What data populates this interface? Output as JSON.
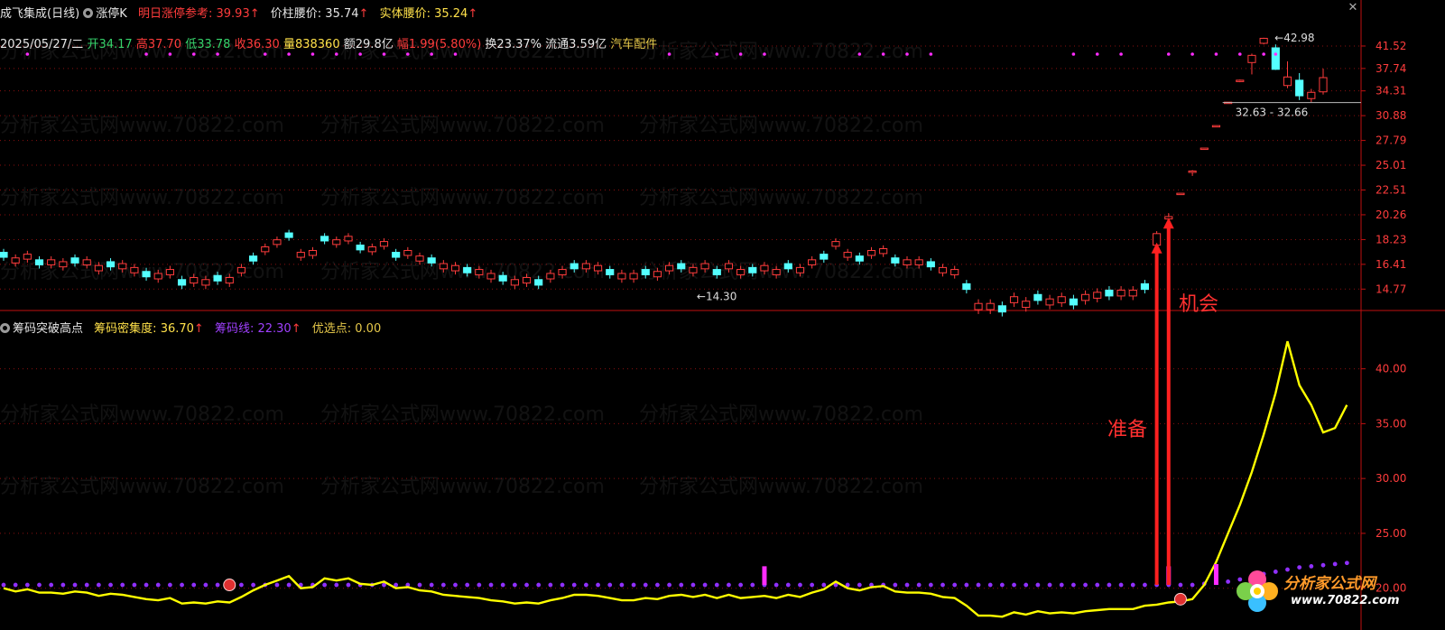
{
  "header": {
    "title": "成飞集成(日线)",
    "indicator_name": "涨停K",
    "ref_label": "明日涨停参考:",
    "ref_value": "39.93",
    "waist_label": "价柱腰价:",
    "waist_value": "35.74",
    "body_waist_label": "实体腰价:",
    "body_waist_value": "35.24",
    "up_arrow": "↑",
    "close_glyph": "✕"
  },
  "quote": {
    "date": "2025/05/27/二",
    "open_label": "开",
    "open": "34.17",
    "high_label": "高",
    "high": "37.70",
    "low_label": "低",
    "low": "33.78",
    "close_label": "收",
    "close": "36.30",
    "vol_label": "量",
    "vol": "838360",
    "amt_label": "额",
    "amt": "29.8亿",
    "chg_label": "幅",
    "chg": "1.99(5.80%)",
    "turn_label": "换",
    "turn": "23.37%",
    "float_label": "流通",
    "float": "3.59亿",
    "sector": "汽车配件"
  },
  "lower_header": {
    "name": "筹码突破高点",
    "density_label": "筹码密集度:",
    "density_value": "36.70",
    "chip_label": "筹码线:",
    "chip_value": "22.30",
    "pick_label": "优选点:",
    "pick_value": "0.00",
    "up_arrow": "↑"
  },
  "annotations": {
    "prepare": "准备",
    "opportunity": "机会",
    "high_marker": "42.98",
    "low_marker": "14.30",
    "range_marker": "32.63 - 32.66"
  },
  "watermark": "分析家公式网www.70822.com",
  "logo": {
    "line1": "分析家公式网",
    "line2": "www.70822.com"
  },
  "colors": {
    "up": "#ff3c3c",
    "down": "#54ffff",
    "limit_up": "#ff2cff",
    "density_line": "#ffff00",
    "chip_dots": "#9030ff",
    "grid": "#8a1010",
    "axis": "#c01010"
  },
  "chart_data": [
    {
      "type": "candlestick",
      "y_ticks": [
        "41.52",
        "37.74",
        "34.31",
        "30.88",
        "27.79",
        "25.01",
        "22.51",
        "20.26",
        "18.23",
        "16.41",
        "14.77"
      ],
      "scale": "log",
      "ylim": [
        13.8,
        45.0
      ],
      "recent_candles": [
        {
          "o": 17.8,
          "c": 18.7,
          "h": 18.9,
          "l": 17.6
        },
        {
          "o": 19.9,
          "c": 20.1,
          "h": 20.4,
          "l": 19.8
        },
        {
          "o": 22.1,
          "c": 22.2,
          "h": 22.2,
          "l": 22.1
        },
        {
          "o": 24.3,
          "c": 24.4,
          "h": 24.5,
          "l": 23.9
        },
        {
          "o": 26.8,
          "c": 26.9,
          "h": 26.9,
          "l": 26.8
        },
        {
          "o": 29.5,
          "c": 29.6,
          "h": 29.6,
          "l": 29.5
        },
        {
          "o": 32.6,
          "c": 32.7,
          "h": 32.7,
          "l": 32.6
        },
        {
          "o": 35.9,
          "c": 35.9,
          "h": 36.0,
          "l": 35.6
        },
        {
          "o": 38.7,
          "c": 39.9,
          "h": 40.2,
          "l": 36.8
        },
        {
          "o": 42.0,
          "c": 42.9,
          "h": 43.0,
          "l": 41.8
        },
        {
          "o": 41.2,
          "c": 37.6,
          "h": 41.8,
          "l": 37.5
        },
        {
          "o": 35.1,
          "c": 36.4,
          "h": 38.9,
          "l": 34.7
        },
        {
          "o": 35.9,
          "c": 33.6,
          "h": 37.0,
          "l": 33.0
        },
        {
          "o": 33.2,
          "c": 34.1,
          "h": 34.6,
          "l": 32.7
        },
        {
          "o": 34.17,
          "c": 36.3,
          "h": 37.7,
          "l": 33.78
        }
      ]
    },
    {
      "type": "line",
      "y_ticks": [
        "40.00",
        "35.00",
        "30.00",
        "25.00",
        "20.00"
      ],
      "ylim": [
        18.0,
        44.0
      ],
      "series": [
        {
          "name": "筹码密集度",
          "color": "#ffff00",
          "values": [
            20.0,
            19.7,
            19.9,
            19.6,
            19.6,
            19.5,
            19.7,
            19.6,
            19.3,
            19.5,
            19.4,
            19.2,
            19.0,
            18.9,
            19.1,
            18.6,
            18.7,
            18.6,
            18.8,
            18.7,
            19.2,
            19.8,
            20.3,
            20.7,
            21.1,
            20.0,
            20.1,
            20.9,
            20.7,
            20.9,
            20.4,
            20.3,
            20.6,
            20.0,
            20.1,
            19.8,
            19.7,
            19.4,
            19.3,
            19.2,
            19.1,
            18.9,
            18.8,
            18.6,
            18.7,
            18.6,
            18.9,
            19.1,
            19.4,
            19.4,
            19.3,
            19.1,
            18.9,
            18.9,
            19.1,
            19.0,
            19.3,
            19.4,
            19.2,
            19.4,
            19.1,
            19.4,
            19.1,
            19.2,
            19.3,
            19.1,
            19.4,
            19.2,
            19.6,
            19.9,
            20.6,
            20.0,
            19.8,
            20.1,
            20.2,
            19.7,
            19.6,
            19.6,
            19.5,
            19.2,
            19.1,
            18.4,
            17.5,
            17.5,
            17.4,
            17.8,
            17.6,
            17.9,
            17.7,
            17.8,
            17.7,
            17.9,
            18.0,
            18.1,
            18.1,
            18.1,
            18.4,
            18.5,
            18.7,
            18.8,
            19.0,
            20.3,
            22.4,
            25.0,
            27.6,
            30.6,
            34.0,
            37.8,
            42.5,
            38.5,
            36.7,
            34.2,
            34.6,
            36.7
          ]
        },
        {
          "name": "筹码线",
          "color": "#9030ff",
          "values": [
            20.3,
            20.3,
            20.3,
            20.3,
            20.3,
            20.3,
            20.3,
            20.3,
            20.3,
            20.3,
            20.3,
            20.3,
            20.3,
            20.3,
            20.3,
            20.3,
            20.3,
            20.3,
            20.3,
            20.3,
            20.3,
            20.3,
            20.3,
            20.3,
            20.3,
            20.3,
            20.3,
            20.3,
            20.3,
            20.3,
            20.3,
            20.3,
            20.3,
            20.3,
            20.3,
            20.3,
            20.3,
            20.3,
            20.3,
            20.3,
            20.3,
            20.3,
            20.3,
            20.3,
            20.3,
            20.3,
            20.3,
            20.3,
            20.3,
            20.3,
            20.3,
            20.3,
            20.3,
            20.3,
            20.3,
            20.3,
            20.3,
            20.3,
            20.3,
            20.3,
            20.3,
            20.3,
            20.3,
            20.3,
            20.3,
            20.3,
            20.3,
            20.3,
            20.3,
            20.3,
            20.3,
            20.3,
            20.3,
            20.3,
            20.3,
            20.3,
            20.3,
            20.3,
            20.3,
            20.3,
            20.3,
            20.3,
            20.3,
            20.3,
            20.3,
            20.3,
            20.3,
            20.3,
            20.3,
            20.3,
            20.3,
            20.3,
            20.3,
            20.3,
            20.3,
            20.3,
            20.3,
            20.3,
            20.3,
            20.3,
            20.3,
            20.4,
            20.5,
            20.6,
            20.8,
            21.0,
            21.3,
            21.5,
            21.7,
            21.9,
            22.0,
            22.1,
            22.2,
            22.3
          ]
        }
      ]
    }
  ]
}
